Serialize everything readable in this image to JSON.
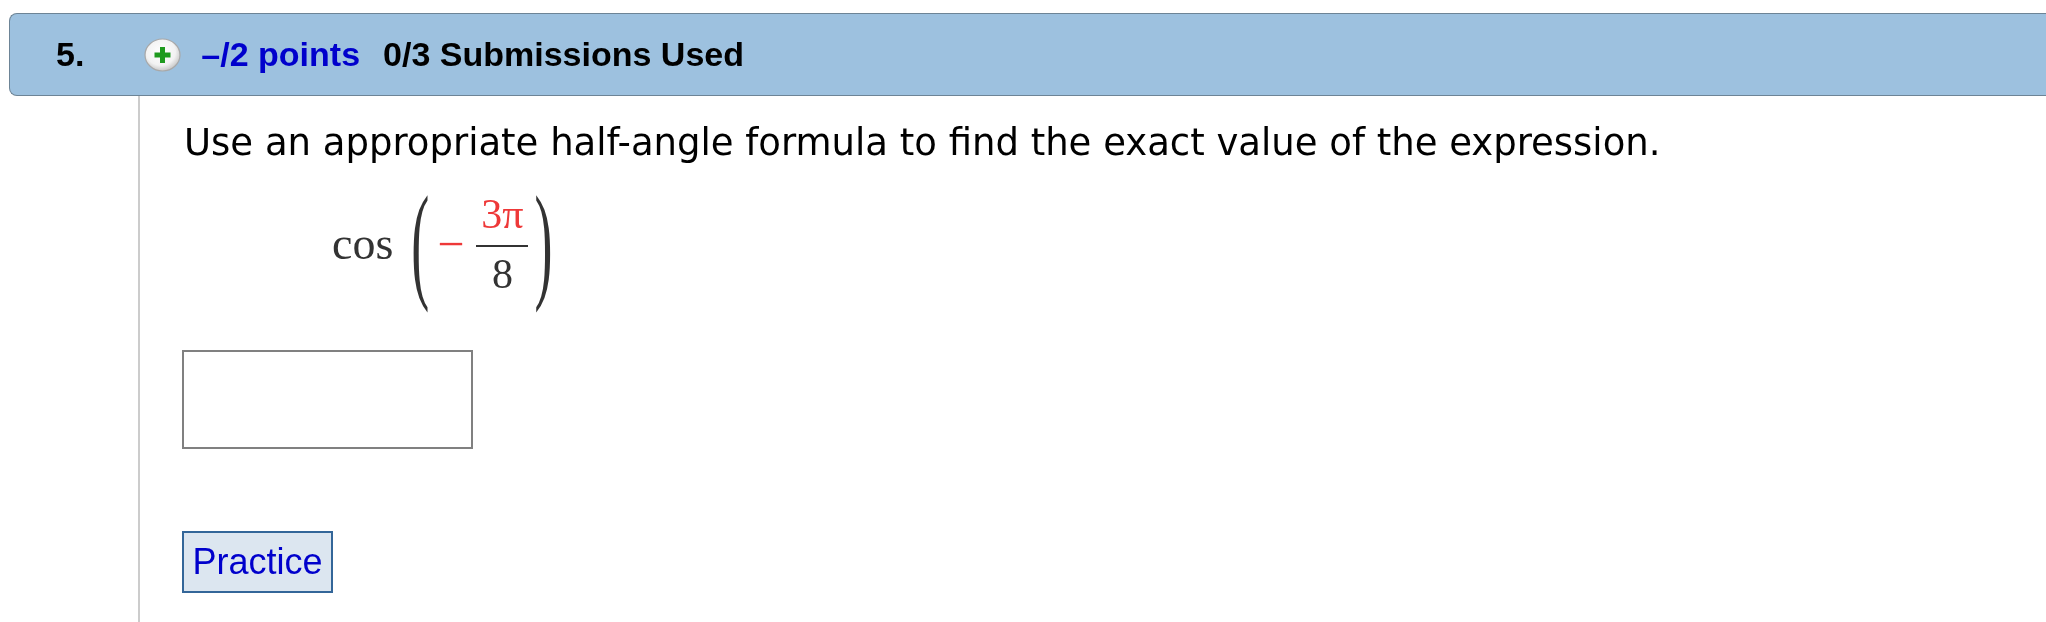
{
  "question": {
    "number": "5.",
    "points": "–/2 points",
    "submissions": "0/3 Submissions Used"
  },
  "prompt": "Use an appropriate half-angle formula to find the exact value of the expression.",
  "expression": {
    "function": "cos",
    "open_paren": "(",
    "sign": {
      "text": "−",
      "highlighted": true
    },
    "numerator": {
      "text": "3π",
      "highlighted": true
    },
    "denominator": {
      "text": "8",
      "highlighted": false
    },
    "close_paren": ")"
  },
  "buttons": [
    "Practice"
  ]
}
